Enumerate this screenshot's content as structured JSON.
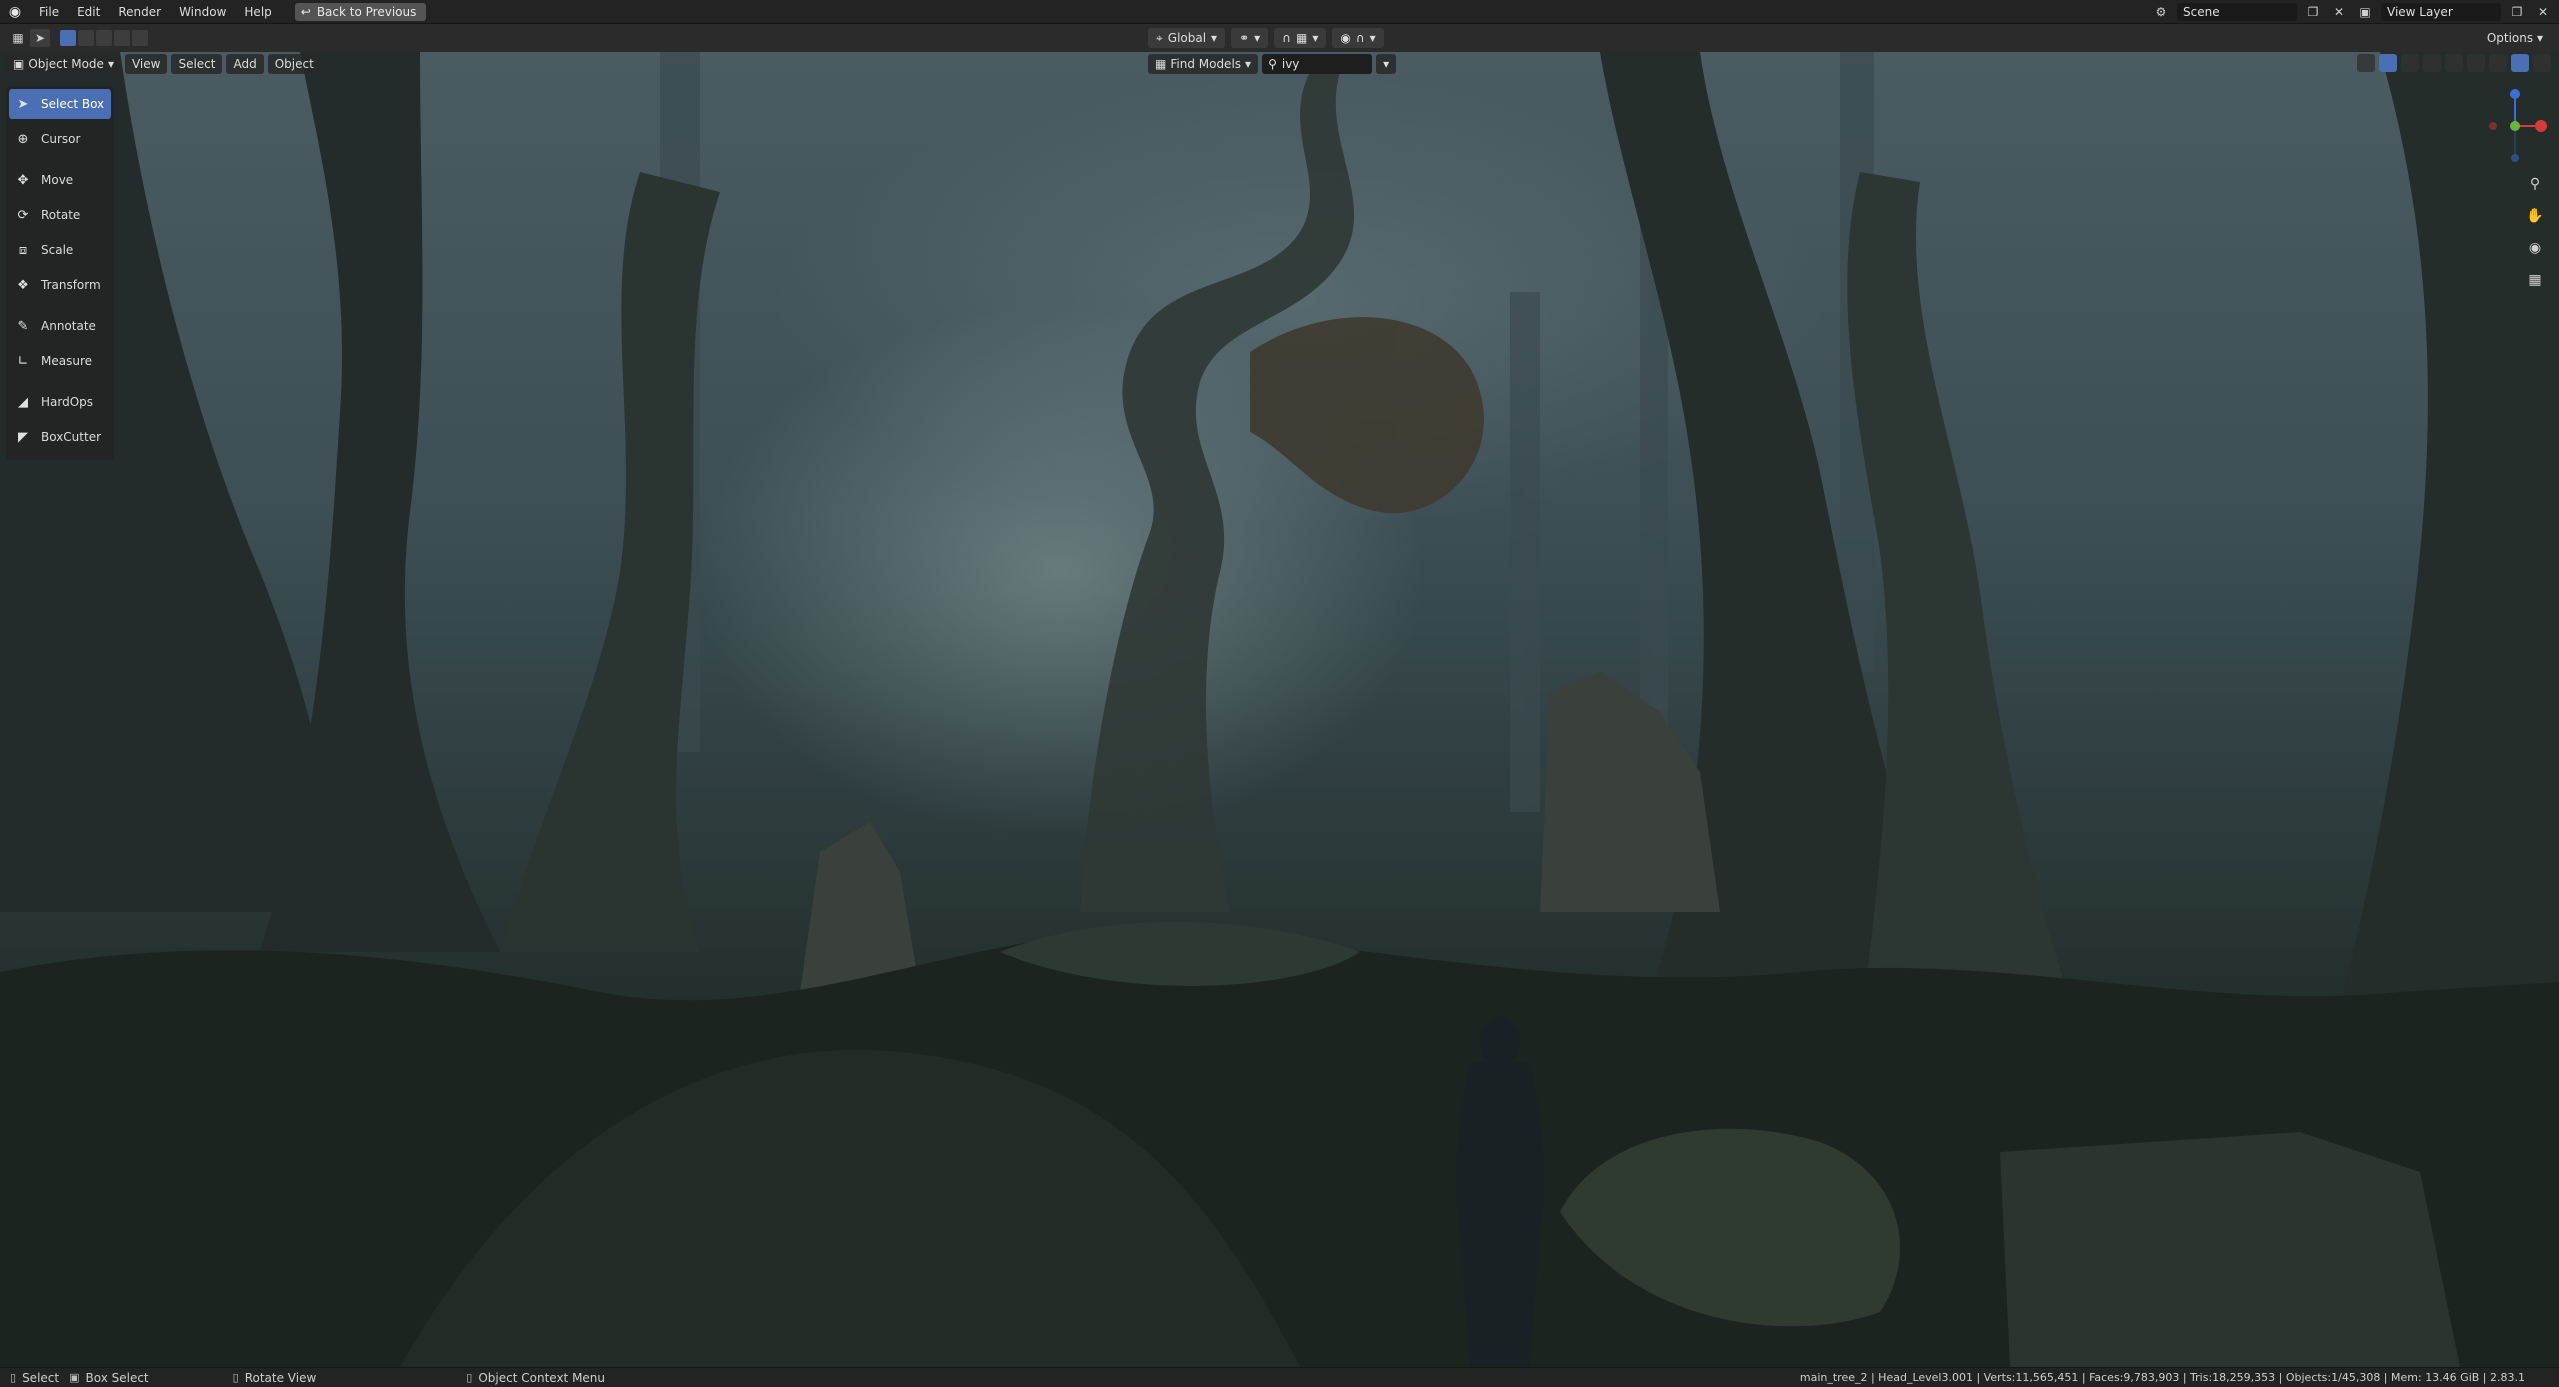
{
  "menu": {
    "items": [
      "File",
      "Edit",
      "Render",
      "Window",
      "Help"
    ],
    "back_button": "Back to Previous"
  },
  "top_right": {
    "scene": "Scene",
    "view_layer": "View Layer"
  },
  "tool_header": {
    "transform_orientation": "Global",
    "options": "Options"
  },
  "viewport_header": {
    "mode": "Object Mode",
    "menus": [
      "View",
      "Select",
      "Add",
      "Object"
    ],
    "find_models": "Find Models",
    "search_value": "ivy"
  },
  "toolbar": {
    "tools": [
      {
        "label": "Select Box",
        "icon": "select-box-icon",
        "active": true
      },
      {
        "label": "Cursor",
        "icon": "cursor-icon",
        "active": false
      },
      {
        "label": "Move",
        "icon": "move-icon",
        "active": false
      },
      {
        "label": "Rotate",
        "icon": "rotate-icon",
        "active": false
      },
      {
        "label": "Scale",
        "icon": "scale-icon",
        "active": false
      },
      {
        "label": "Transform",
        "icon": "transform-icon",
        "active": false
      },
      {
        "label": "Annotate",
        "icon": "annotate-icon",
        "active": false
      },
      {
        "label": "Measure",
        "icon": "measure-icon",
        "active": false
      },
      {
        "label": "HardOps",
        "icon": "hardops-icon",
        "active": false
      },
      {
        "label": "BoxCutter",
        "icon": "boxcutter-icon",
        "active": false
      }
    ]
  },
  "statusbar": {
    "select": "Select",
    "box_select": "Box Select",
    "rotate_view": "Rotate View",
    "context_menu": "Object Context Menu",
    "stats": "main_tree_2 | Head_Level3.001 | Verts:11,565,451 | Faces:9,783,903 | Tris:18,259,353 | Objects:1/45,308 | Mem: 13.46 GiB | 2.83.1"
  },
  "colors": {
    "accent": "#4a6fb5",
    "header_bg": "#232323",
    "panel_bg": "#2b2b2b"
  }
}
